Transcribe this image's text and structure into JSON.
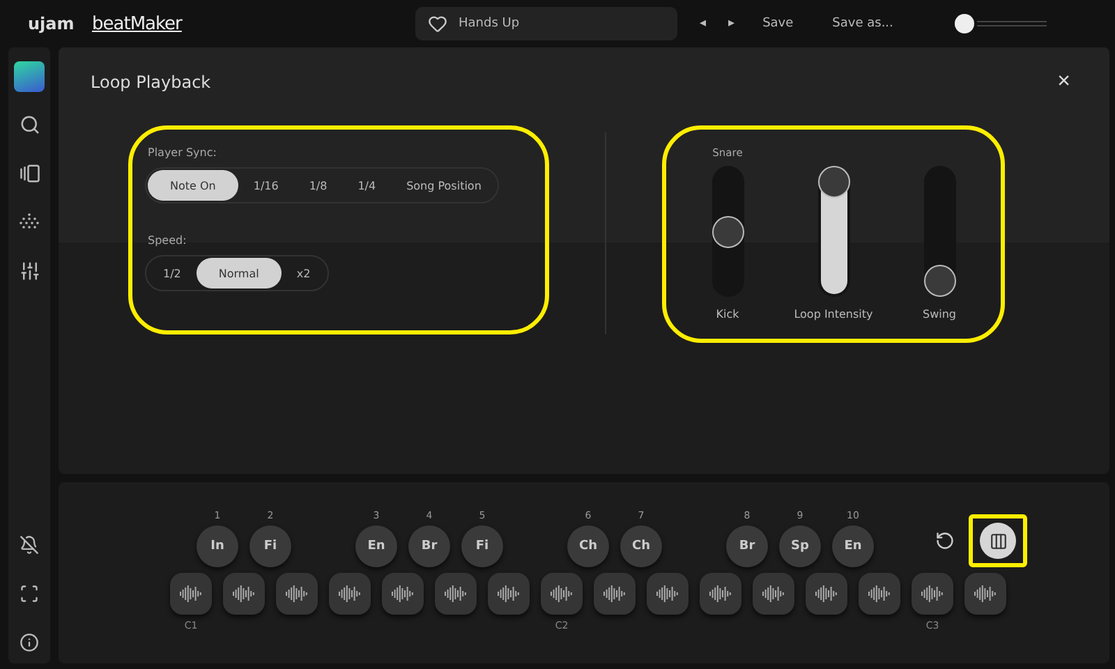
{
  "topbar": {
    "brand": "ujam",
    "product": "beatMaker",
    "preset": "Hands Up",
    "prev": "◂",
    "next": "▸",
    "save": "Save",
    "save_as": "Save as..."
  },
  "panel": {
    "title": "Loop Playback",
    "close": "×",
    "sync": {
      "highlighted": true,
      "player_sync_label": "Player Sync:",
      "player_sync": [
        {
          "label": "Note On",
          "selected": true
        },
        {
          "label": "1/16",
          "selected": false
        },
        {
          "label": "1/8",
          "selected": false
        },
        {
          "label": "1/4",
          "selected": false
        },
        {
          "label": "Song Position",
          "selected": false
        }
      ],
      "speed_label": "Speed:",
      "speed": [
        {
          "label": "1/2",
          "selected": false
        },
        {
          "label": "Normal",
          "selected": true
        },
        {
          "label": "x2",
          "selected": false
        }
      ]
    },
    "sliders": {
      "highlighted": true,
      "items": [
        {
          "kind": "balance",
          "top_label": "Snare",
          "label": "Kick",
          "level": 0.5
        },
        {
          "kind": "amount",
          "label": "Loop Intensity",
          "level": 1
        },
        {
          "kind": "amount",
          "label": "Swing",
          "level": 0
        }
      ]
    }
  },
  "pads": {
    "phrases": [
      {
        "number": "1",
        "label": "In"
      },
      {
        "number": "2",
        "label": "Fi"
      },
      {
        "number": "3",
        "label": "En"
      },
      {
        "number": "4",
        "label": "Br"
      },
      {
        "number": "5",
        "label": "Fi"
      },
      {
        "number": "6",
        "label": "Ch"
      },
      {
        "number": "7",
        "label": "Ch"
      },
      {
        "number": "8",
        "label": "Br"
      },
      {
        "number": "9",
        "label": "Sp"
      },
      {
        "number": "10",
        "label": "En"
      }
    ],
    "octaves": [
      "C1",
      "C2",
      "C3"
    ],
    "settings_highlighted": true
  }
}
